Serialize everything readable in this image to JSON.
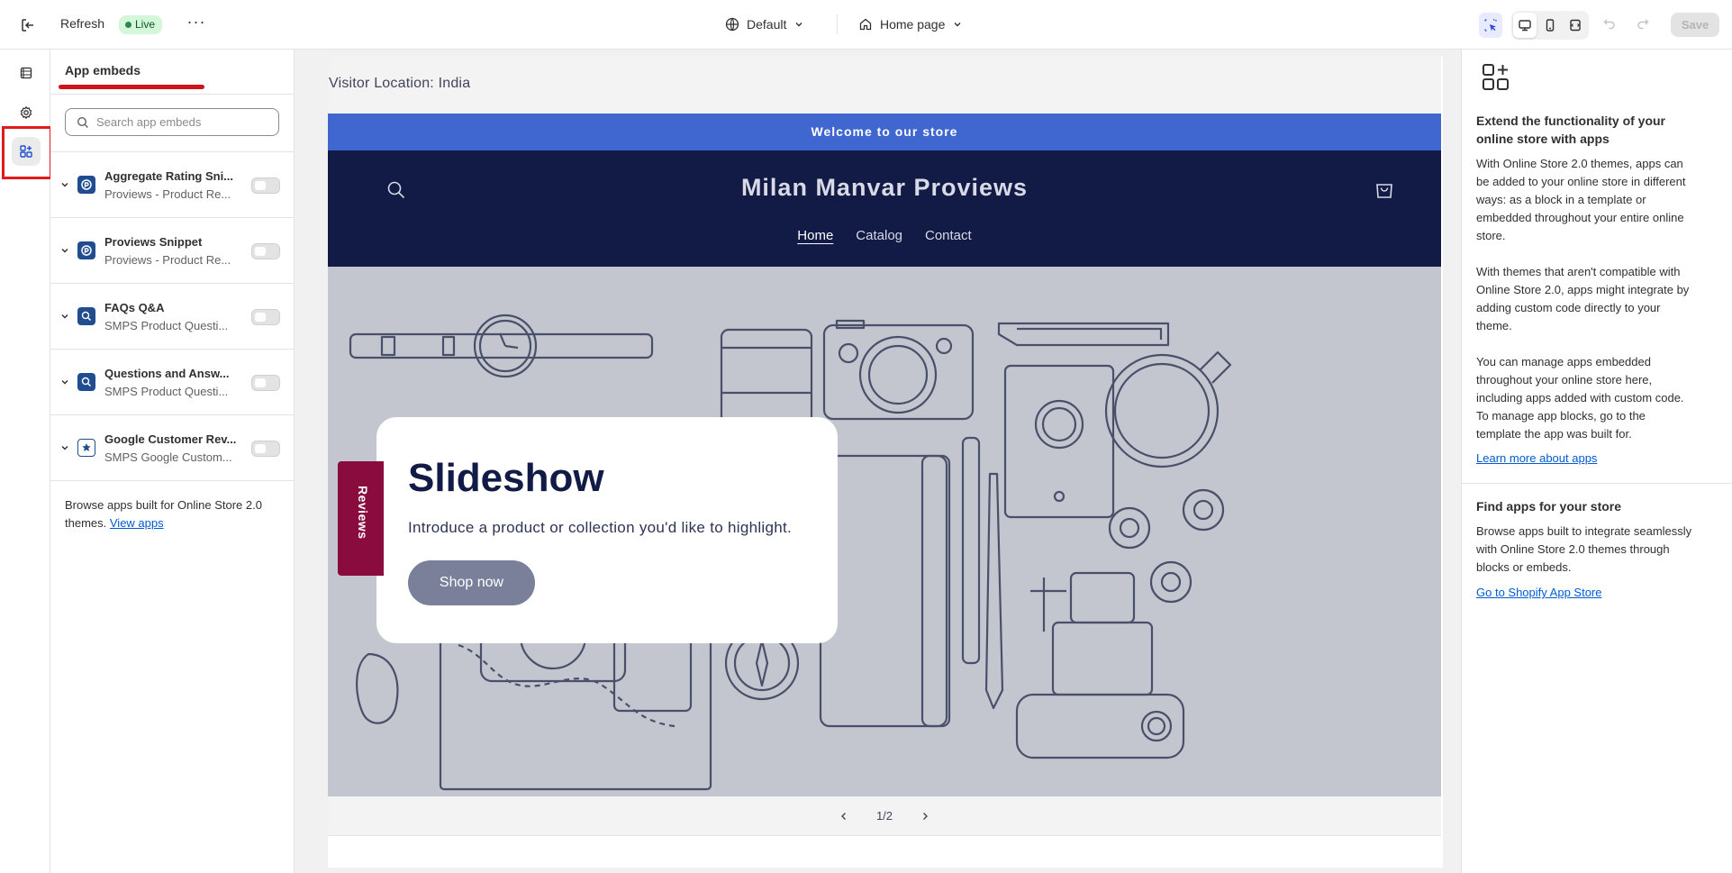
{
  "topbar": {
    "refresh_label": "Refresh",
    "live_badge": "Live",
    "more_label": "···",
    "theme_label": "Default",
    "page_label": "Home page",
    "save_label": "Save"
  },
  "panel": {
    "title": "App embeds",
    "search_placeholder": "Search app embeds",
    "items": [
      {
        "name": "Aggregate Rating Sni...",
        "sub": "Proviews - Product Re...",
        "icon": "proviews-icon",
        "enabled": false
      },
      {
        "name": "Proviews Snippet",
        "sub": "Proviews - Product Re...",
        "icon": "proviews-icon",
        "enabled": false
      },
      {
        "name": "FAQs Q&A",
        "sub": "SMPS Product Questi...",
        "icon": "smps-qa-icon",
        "enabled": false
      },
      {
        "name": "Questions and Answ...",
        "sub": "SMPS Product Questi...",
        "icon": "smps-qa-icon",
        "enabled": false
      },
      {
        "name": "Google Customer Rev...",
        "sub": "SMPS Google Custom...",
        "icon": "google-review-star-icon",
        "enabled": false
      }
    ],
    "browse_text": "Browse apps built for Online Store 2.0 themes.",
    "browse_link": "View apps"
  },
  "preview": {
    "visitor_location": "Visitor Location: India",
    "announcement": "Welcome to our store",
    "store_name": "Milan Manvar Proviews",
    "nav": [
      "Home",
      "Catalog",
      "Contact"
    ],
    "slide_title": "Slideshow",
    "slide_text": "Introduce a product or collection you'd like to highlight.",
    "slide_button": "Shop now",
    "reviews_tab": "Reviews",
    "slide_counter": "1/2"
  },
  "right": {
    "heading1": "Extend the functionality of your online store with apps",
    "para1": "With Online Store 2.0 themes, apps can be added to your online store in different ways: as a block in a template or embedded throughout your entire online store.",
    "para2": "With themes that aren't compatible with Online Store 2.0, apps might integrate by adding custom code directly to your theme.",
    "para3": "You can manage apps embedded throughout your online store here, including apps added with custom code. To manage app blocks, go to the template the app was built for.",
    "link1": "Learn more about apps",
    "heading2": "Find apps for your store",
    "para4": "Browse apps built to integrate seamlessly with Online Store 2.0 themes through blocks or embeds.",
    "link2": "Go to Shopify App Store"
  },
  "colors": {
    "announcement_bg": "#4066cf",
    "header_bg": "#121a46",
    "reviews_tab_bg": "#8a0b3d",
    "highlight": "#e11b1b",
    "link": "#005bd3"
  }
}
